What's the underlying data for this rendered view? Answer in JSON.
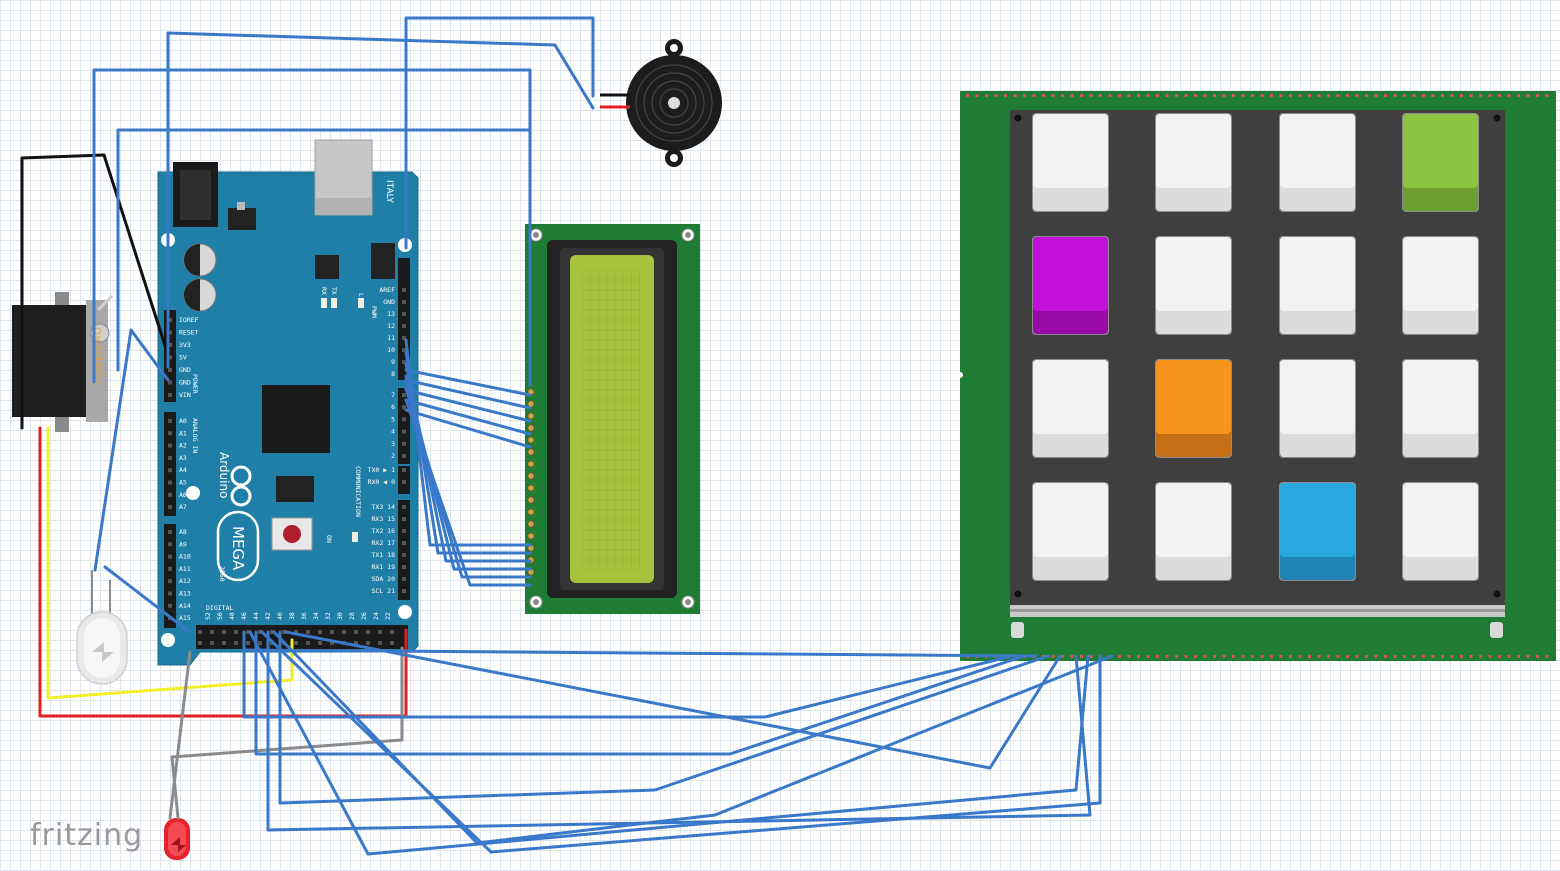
{
  "watermark": "fritzing",
  "arduino": {
    "label_italy": "ITALY",
    "label_arduino": "Arduino",
    "label_mega": "MEGA",
    "label_2560": "2560",
    "label_power": "POWER",
    "label_analog_in": "ANALOG IN",
    "label_digital": "DIGITAL",
    "label_pwm": "PWM",
    "label_communication": "COMMUNICATION",
    "label_on": "ON",
    "label_l": "L",
    "label_tx": "TX",
    "label_rx": "RX",
    "power_pins": [
      "IOREF",
      "RESET",
      "3V3",
      "5V",
      "GND",
      "GND",
      "VIN"
    ],
    "analog_pins": [
      "A0",
      "A1",
      "A2",
      "A3",
      "A4",
      "A5",
      "A6",
      "A7",
      "A8",
      "A9",
      "A10",
      "A11",
      "A12",
      "A13",
      "A14",
      "A15"
    ],
    "pwm_pins": [
      "AREF",
      "GND",
      "13",
      "12",
      "11",
      "10",
      "9",
      "8",
      "7",
      "6",
      "5",
      "4",
      "3",
      "2"
    ],
    "comm_pins": [
      "TX0 ▶ 1",
      "RX0 ◀ 0",
      "TX3 14",
      "RX3 15",
      "TX2 16",
      "RX2 17",
      "TX1 18",
      "RX1 19",
      "SDA 20",
      "SCL 21"
    ]
  },
  "colors": {
    "wire_blue": "#3a78c9",
    "wire_red": "#e02020",
    "wire_yellow": "#f2ef2a",
    "wire_black": "#111111",
    "wire_gray": "#8c8c8c",
    "arduino_board": "#1f7fa6",
    "pcb_green": "#1f7c35",
    "lcd_screen": "#a7c23c",
    "key_green": "#8bc43f",
    "key_purple": "#c40fd8",
    "key_orange": "#f7941e",
    "key_blue": "#29a8e0",
    "key_white": "#f2f2f2"
  },
  "keypad": {
    "rows": [
      [
        "white",
        "white",
        "white",
        "green"
      ],
      [
        "purple",
        "white",
        "white",
        "white"
      ],
      [
        "white",
        "orange",
        "white",
        "white"
      ],
      [
        "white",
        "white",
        "blue",
        "white"
      ]
    ]
  },
  "components": [
    "servo-motor",
    "piezo-buzzer",
    "arduino-mega-2560",
    "lcd-16x2",
    "keypad-4x4",
    "white-led",
    "red-led"
  ]
}
